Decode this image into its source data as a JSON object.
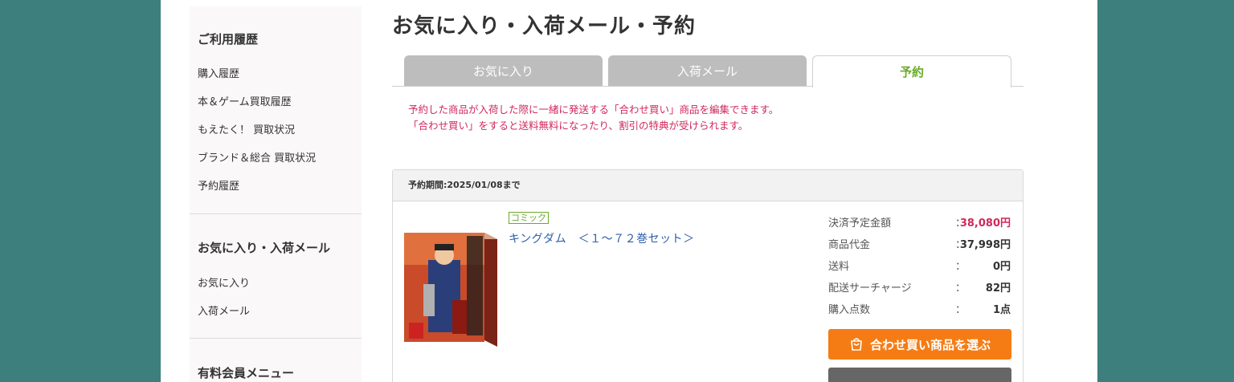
{
  "sidebar": {
    "history_title": "ご利用履歴",
    "history_links": [
      "購入履歴",
      "本＆ゲーム買取履歴",
      "もえたく！ 買取状況",
      "ブランド＆総合 買取状況",
      "予約履歴"
    ],
    "favorites_title": "お気に入り・入荷メール",
    "favorites_links": [
      "お気に入り",
      "入荷メール"
    ],
    "paid_title": "有料会員メニュー"
  },
  "main": {
    "title": "お気に入り・入荷メール・予約",
    "tabs": [
      "お気に入り",
      "入荷メール",
      "予約"
    ],
    "active_tab": "予約",
    "notice_lines": [
      "予約した商品が入荷した際に一緒に発送する「合わせ買い」商品を編集できます。",
      "「合わせ買い」をすると送料無料になったり、割引の特典が受けられます。"
    ]
  },
  "reservation": {
    "period": "予約期間:2025/01/08まで",
    "genre": "コミック",
    "product_name": "キングダム　＜１〜７２巻セット＞",
    "summary": [
      {
        "label": "決済予定金額",
        "colon": "：",
        "value": "38,080円"
      },
      {
        "label": "商品代金",
        "colon": "：",
        "value": "37,998円"
      },
      {
        "label": "送料",
        "colon": "：",
        "value": "0円"
      },
      {
        "label": "配送サーチャージ",
        "colon": "：",
        "value": "82円"
      },
      {
        "label": "購入点数",
        "colon": "：",
        "value": "1点"
      }
    ],
    "bundle_button": "合わせ買い商品を選ぶ"
  },
  "colors": {
    "background": "#3d7f7c",
    "accent_pink": "#d0285c",
    "accent_green": "#6aaa2a",
    "button_orange": "#f57c14",
    "link_blue": "#2f5fa8"
  },
  "icons": [
    "cart-icon"
  ]
}
